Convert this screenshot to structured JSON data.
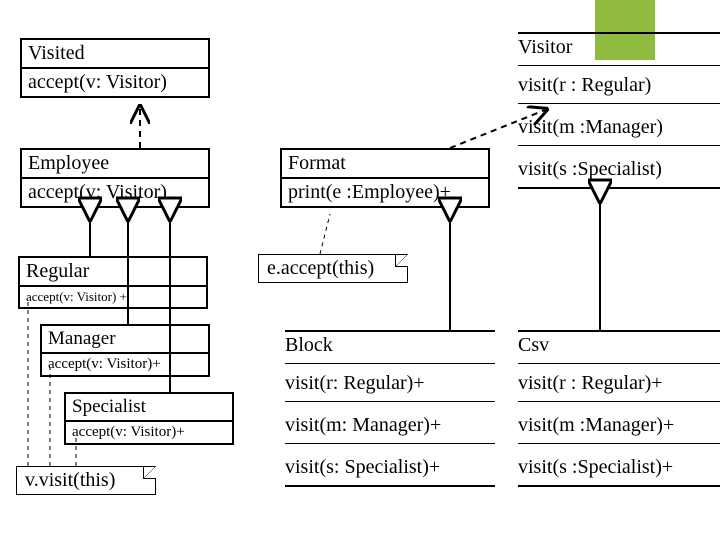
{
  "visited": {
    "name": "Visited",
    "method": "accept(v: Visitor)"
  },
  "employee": {
    "name": "Employee",
    "method": "accept(v: Visitor)"
  },
  "regular": {
    "name": "Regular",
    "method": "accept(v: Visitor) +"
  },
  "manager": {
    "name": "Manager",
    "method": "accept(v: Visitor)+"
  },
  "specialist": {
    "name": "Specialist",
    "method": "accept(v: Visitor)+"
  },
  "format": {
    "name": "Format",
    "method": "print(e :Employee)+"
  },
  "block": {
    "name": "Block",
    "m1": "visit(r: Regular)+",
    "m2": "visit(m: Manager)+",
    "m3": "visit(s: Specialist)+"
  },
  "visitor": {
    "name": "Visitor",
    "m1": "visit(r : Regular)",
    "m2": "visit(m :Manager)",
    "m3": "visit(s :Specialist)"
  },
  "csv": {
    "name": "Csv",
    "m1": "visit(r : Regular)+",
    "m2": "visit(m :Manager)+",
    "m3": "visit(s :Specialist)+"
  },
  "notes": {
    "eaccept": "e.accept(this)",
    "vvisit": "v.visit(this)"
  },
  "chart_data": {
    "type": "table",
    "uml_classes": [
      {
        "name": "Visited",
        "abstract": true,
        "methods": [
          "accept(v: Visitor)"
        ]
      },
      {
        "name": "Employee",
        "extends": "Visited",
        "methods": [
          "accept(v: Visitor)"
        ]
      },
      {
        "name": "Regular",
        "extends": "Employee",
        "methods": [
          "accept(v: Visitor) +"
        ]
      },
      {
        "name": "Manager",
        "extends": "Regular",
        "methods": [
          "accept(v: Visitor)+"
        ]
      },
      {
        "name": "Specialist",
        "extends": "Manager",
        "methods": [
          "accept(v: Visitor)+"
        ]
      },
      {
        "name": "Format",
        "methods": [
          "print(e :Employee)+"
        ]
      },
      {
        "name": "Block",
        "extends": "Format",
        "methods": [
          "visit(r: Regular)+",
          "visit(m: Manager)+",
          "visit(s: Specialist)+"
        ]
      },
      {
        "name": "Visitor",
        "abstract": true,
        "methods": [
          "visit(r : Regular)",
          "visit(m :Manager)",
          "visit(s :Specialist)"
        ]
      },
      {
        "name": "Csv",
        "extends": "Visitor",
        "methods": [
          "visit(r : Regular)+",
          "visit(m :Manager)+",
          "visit(s :Specialist)+"
        ]
      }
    ],
    "notes": [
      {
        "text": "e.accept(this)",
        "attached_to": "Format.print"
      },
      {
        "text": "v.visit(this)",
        "attached_to": "Regular/Manager/Specialist.accept"
      }
    ]
  }
}
